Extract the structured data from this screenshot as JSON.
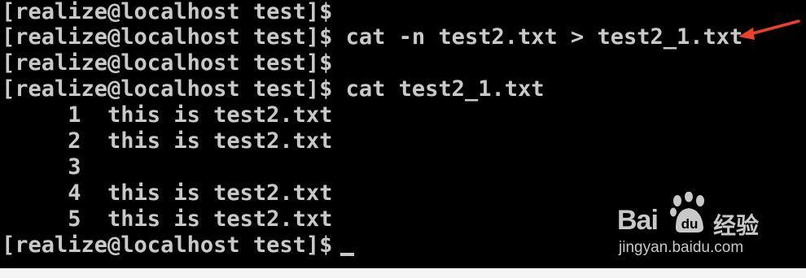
{
  "terminal": {
    "lines": [
      "[realize@localhost test]$",
      "[realize@localhost test]$ cat -n test2.txt > test2_1.txt",
      "[realize@localhost test]$",
      "[realize@localhost test]$ cat test2_1.txt",
      "     1  this is test2.txt",
      "     2  this is test2.txt",
      "     3",
      "     4  this is test2.txt",
      "     5  this is test2.txt",
      "[realize@localhost test]$ "
    ],
    "cursor": "_"
  },
  "annotation": {
    "arrow_color": "#e8412c"
  },
  "watermark": {
    "brand_left": "Bai",
    "brand_paw": "du",
    "brand_cn": "经验",
    "url": "jingyan.baidu.com"
  },
  "colors": {
    "terminal_bg": "#000000",
    "terminal_fg": "#c9c9c9"
  }
}
